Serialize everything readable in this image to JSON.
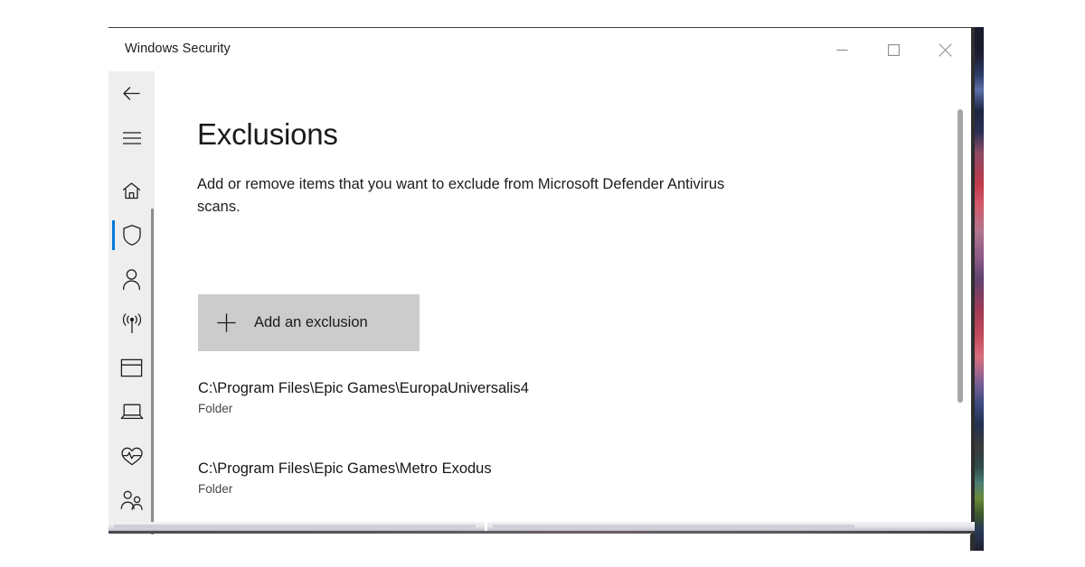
{
  "window": {
    "title": "Windows Security",
    "caption_buttons": [
      {
        "name": "minimize",
        "glyph": "minimize-icon"
      },
      {
        "name": "maximize",
        "glyph": "maximize-icon"
      },
      {
        "name": "close",
        "glyph": "close-icon"
      }
    ]
  },
  "sidebar": {
    "accent_color": "#0078d7",
    "background_color": "#eeeeee",
    "items": [
      {
        "icon": "back-arrow-icon",
        "name": "back",
        "selected": false
      },
      {
        "icon": "hamburger-menu-icon",
        "name": "menu",
        "selected": false
      },
      {
        "icon": "home-icon",
        "name": "home",
        "selected": false
      },
      {
        "icon": "shield-icon",
        "name": "virus-and-threat-protection",
        "selected": true
      },
      {
        "icon": "person-icon",
        "name": "account-protection",
        "selected": false
      },
      {
        "icon": "wifi-signal-icon",
        "name": "firewall-and-network-protection",
        "selected": false
      },
      {
        "icon": "app-window-icon",
        "name": "app-and-browser-control",
        "selected": false
      },
      {
        "icon": "laptop-icon",
        "name": "device-security",
        "selected": false
      },
      {
        "icon": "heart-pulse-icon",
        "name": "device-performance-and-health",
        "selected": false
      },
      {
        "icon": "family-people-icon",
        "name": "family-options",
        "selected": false
      }
    ]
  },
  "main": {
    "title": "Exclusions",
    "description": "Add or remove items that you want to exclude from Microsoft Defender Antivirus scans.",
    "add_button": {
      "label": "Add an exclusion",
      "icon": "plus-icon",
      "background_color": "#cccccc"
    },
    "exclusions": [
      {
        "path": "C:\\Program Files\\Epic Games\\EuropaUniversalis4",
        "type": "Folder"
      },
      {
        "path": "C:\\Program Files\\Epic Games\\Metro Exodus",
        "type": "Folder"
      }
    ]
  }
}
